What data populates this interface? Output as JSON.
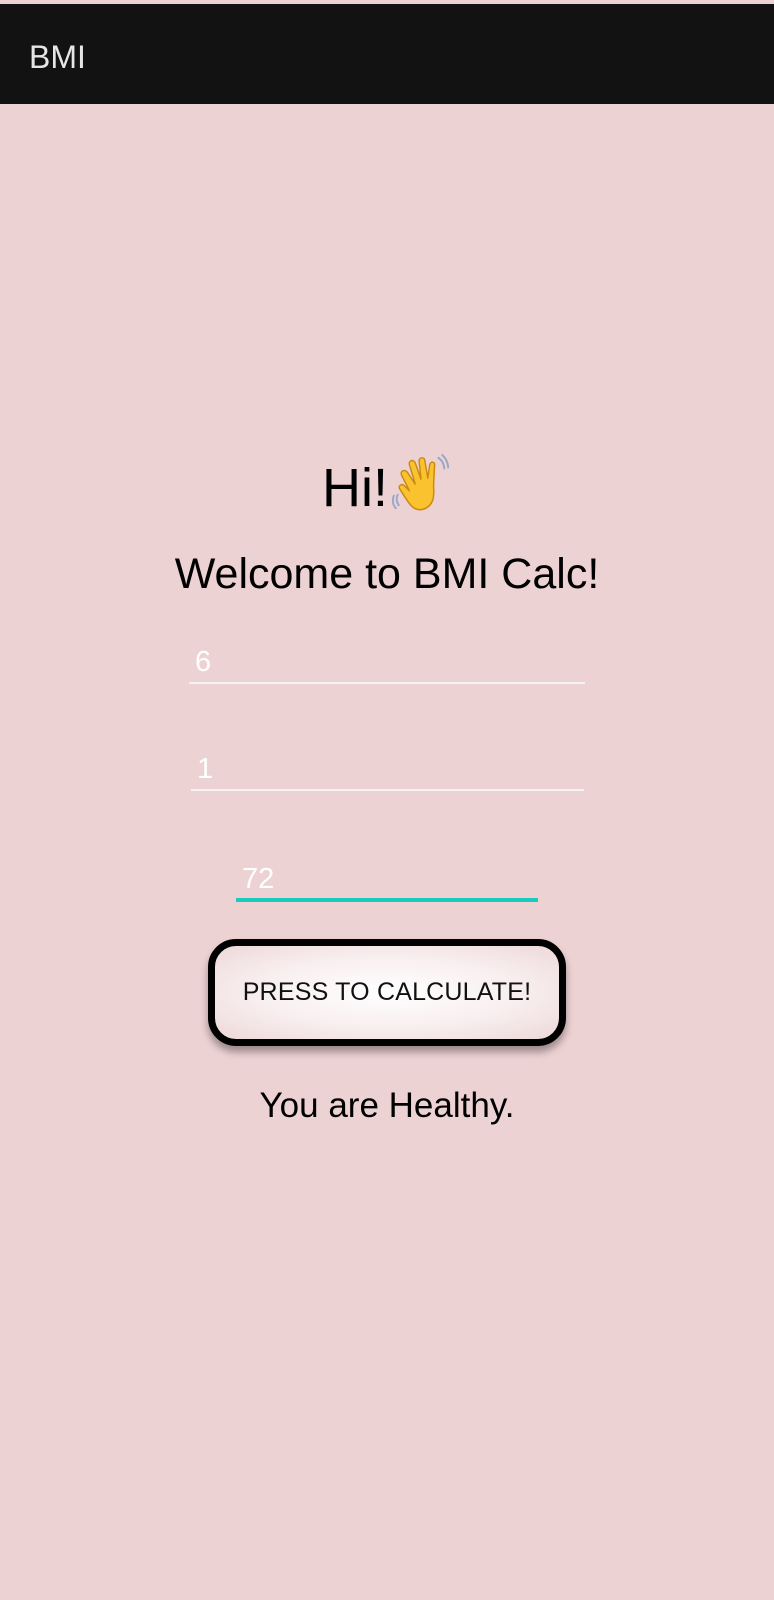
{
  "app_bar": {
    "title": "BMI"
  },
  "main": {
    "greeting": "Hi!",
    "greeting_icon": "waving-hand-icon",
    "welcome": "Welcome to BMI Calc!",
    "fields": [
      {
        "value": "6"
      },
      {
        "value": "1"
      },
      {
        "value": "72"
      }
    ],
    "button_label": "PRESS TO CALCULATE!",
    "result": "You are Healthy."
  },
  "colors": {
    "background": "#EDD2D3",
    "app_bar": "#121212",
    "focus_accent": "#19CCC0",
    "input_text": "#FFFFFF"
  }
}
